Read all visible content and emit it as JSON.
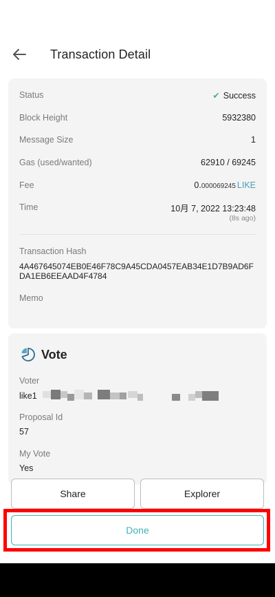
{
  "header": {
    "title": "Transaction Detail"
  },
  "tx": {
    "status_label": "Status",
    "status_value": "Success",
    "block_height_label": "Block Height",
    "block_height_value": "5932380",
    "message_size_label": "Message Size",
    "message_size_value": "1",
    "gas_label": "Gas (used/wanted)",
    "gas_value": "62910 / 69245",
    "fee_label": "Fee",
    "fee_integer": "0.",
    "fee_fraction": "000069245",
    "fee_denom": "LIKE",
    "time_label": "Time",
    "time_value": "10月 7, 2022 13:23:48",
    "time_ago": "(8s ago)",
    "hash_label": "Transaction Hash",
    "hash_value": "4A467645074EB0E46F78C9A45CDA0457EAB34E1D7B9AD6FDA1EB6EEAAD4F4784",
    "memo_label": "Memo"
  },
  "message": {
    "title": "Vote",
    "voter_label": "Voter",
    "voter_prefix": "like1",
    "proposal_label": "Proposal Id",
    "proposal_value": "57",
    "my_vote_label": "My Vote",
    "my_vote_value": "Yes"
  },
  "buttons": {
    "share": "Share",
    "explorer": "Explorer",
    "done": "Done"
  },
  "colors": {
    "accent": "#3fb1b7",
    "success": "#4caf7a",
    "highlight": "#ff0000"
  }
}
